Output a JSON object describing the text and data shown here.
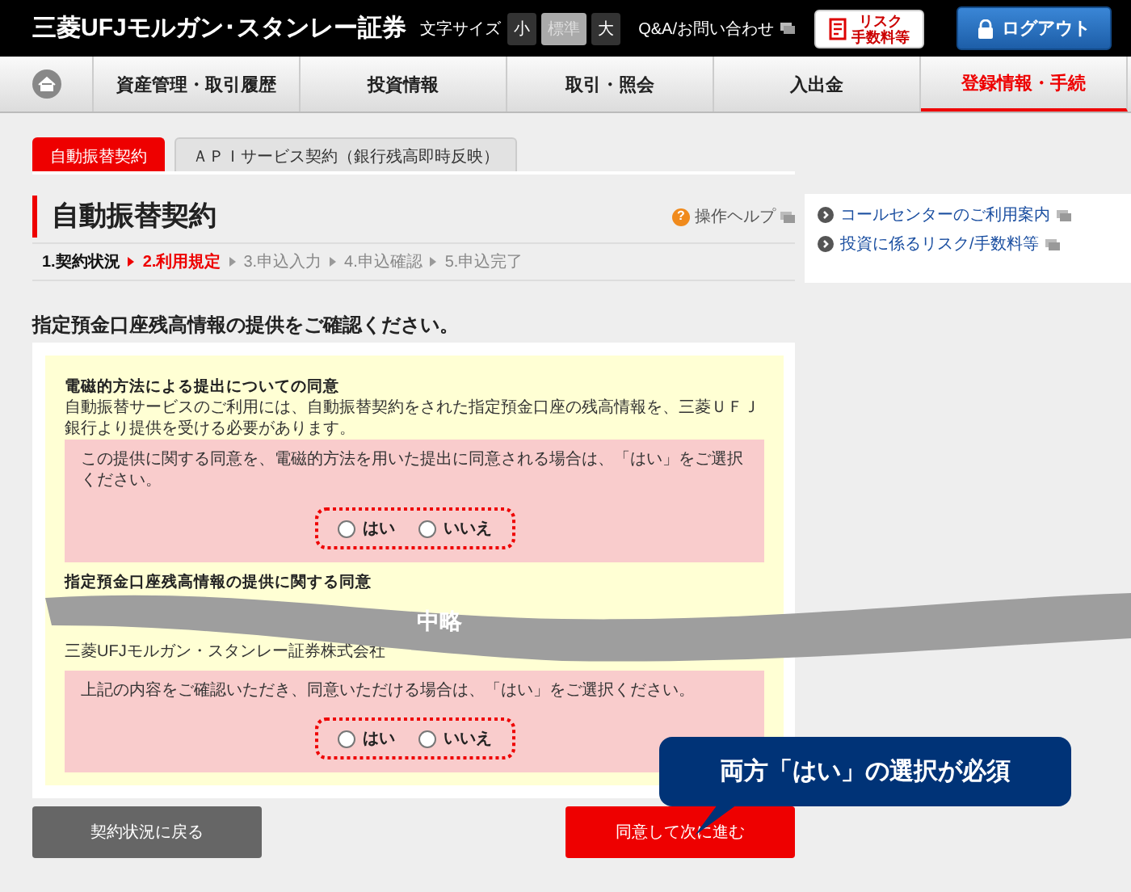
{
  "header": {
    "logo": "三菱UFJモルガン･スタンレー証券",
    "font_size_label": "文字サイズ",
    "font_sizes": [
      {
        "label": "小",
        "selected": false
      },
      {
        "label": "標準",
        "selected": true
      },
      {
        "label": "大",
        "selected": false
      }
    ],
    "help_link": "Q&A/お問い合わせ",
    "risk_button": [
      "リスク",
      "手数料等"
    ],
    "logout_button": "ログアウト"
  },
  "nav": {
    "items": [
      {
        "label": "資産管理・取引履歴",
        "selected": false
      },
      {
        "label": "投資情報",
        "selected": false
      },
      {
        "label": "取引・照会",
        "selected": false
      },
      {
        "label": "入出金",
        "selected": false
      },
      {
        "label": "登録情報・手続",
        "selected": true
      }
    ]
  },
  "tabs": [
    {
      "label": "自動振替契約",
      "selected": true
    },
    {
      "label": "ＡＰＩサービス契約（銀行残高即時反映）",
      "selected": false
    }
  ],
  "page_title": "自動振替契約",
  "help_icon": "?",
  "operation_help": "操作ヘルプ",
  "steps": [
    {
      "label": "1.契約状況",
      "selected": false
    },
    {
      "label": "2.利用規定",
      "selected": true
    },
    {
      "label": "3.申込入力",
      "selected": false
    },
    {
      "label": "4.申込確認",
      "selected": false
    },
    {
      "label": "5.申込完了",
      "selected": false
    }
  ],
  "side_links": [
    "コールセンターのご利用案内",
    "投資に係るリスク/手数料等"
  ],
  "consent_heading": "指定預金口座残高情報の提供をご確認ください。",
  "sections": [
    {
      "title": "電磁的方法による提出についての同意",
      "body": "自動振替サービスのご利用には、自動振替契約をされた指定預金口座の残高情報を、三菱ＵＦＪ銀行より提供を受ける必要があります。",
      "prompt": "この提供に関する同意を、電磁的方法を用いた提出に同意される場合は、「はい」をご選択ください。",
      "options": [
        {
          "label": "はい",
          "selected": false
        },
        {
          "label": "いいえ",
          "selected": false
        }
      ]
    },
    {
      "title": "指定預金口座残高情報の提供に関する同意",
      "body": "三菱UFJモルガン・スタンレー証券株式会社",
      "prompt": "上記の内容をご確認いただき、同意いただける場合は、「はい」をご選択ください。",
      "options": [
        {
          "label": "はい",
          "selected": false
        },
        {
          "label": "いいえ",
          "selected": false
        }
      ]
    }
  ],
  "omission_label": "中略",
  "callout": "両方「はい」の選択が必須",
  "buttons": {
    "back": "契約状況に戻る",
    "next": "同意して次に進む"
  }
}
